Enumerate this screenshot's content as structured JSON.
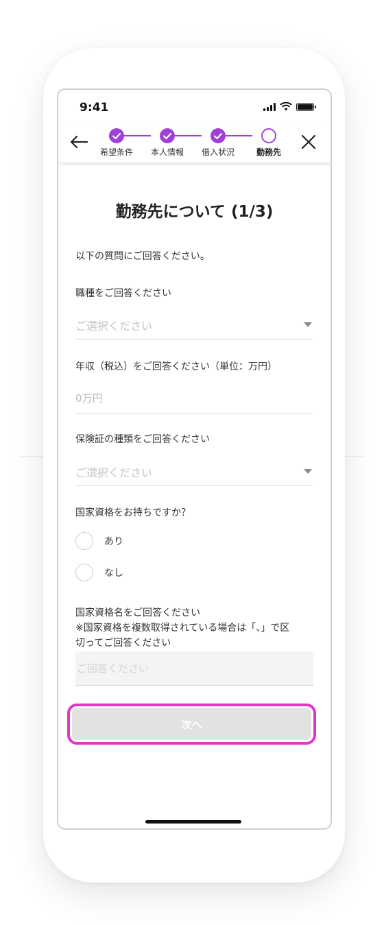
{
  "status_bar": {
    "time": "9:41"
  },
  "header": {
    "steps": [
      {
        "label": "希望条件",
        "state": "done"
      },
      {
        "label": "本人情報",
        "state": "done"
      },
      {
        "label": "借入状況",
        "state": "done"
      },
      {
        "label": "勤務先",
        "state": "current"
      }
    ],
    "accent_color": "#a040d8"
  },
  "form": {
    "title": "勤務先について (1/3)",
    "intro": "以下の質問にご回答ください。",
    "job_type": {
      "label": "職種をご回答ください",
      "placeholder": "ご選択ください"
    },
    "annual_income": {
      "label": "年収（税込）をご回答ください（単位：万円）",
      "placeholder": "0万円"
    },
    "insurance_card": {
      "label": "保険証の種類をご回答ください",
      "placeholder": "ご選択ください"
    },
    "national_qualification": {
      "label": "国家資格をお持ちですか？",
      "options": [
        {
          "label": "あり"
        },
        {
          "label": "なし"
        }
      ]
    },
    "qualification_name": {
      "label_lines": [
        "国家資格名をご回答ください",
        "※国家資格を複数取得されている場合は「、」で区",
        "切ってご回答ください"
      ],
      "placeholder": "ご回答ください"
    },
    "next_button": "次へ"
  }
}
